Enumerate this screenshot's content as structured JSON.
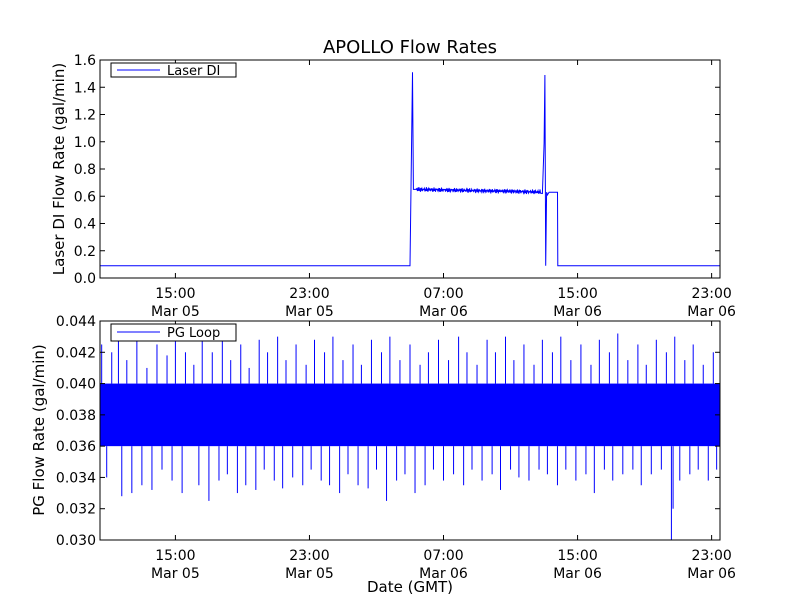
{
  "figure": {
    "title": "APOLLO Flow Rates",
    "xlabel": "Date (GMT)"
  },
  "chart_data": [
    {
      "type": "line",
      "ylabel": "Laser DI Flow Rate (gal/min)",
      "ylim": [
        0.0,
        1.6
      ],
      "yticks": [
        "0.0",
        "0.2",
        "0.4",
        "0.6",
        "0.8",
        "1.0",
        "1.2",
        "1.4",
        "1.6"
      ],
      "xlim_hours": [
        10.5,
        47.5
      ],
      "xticks": [
        {
          "h": 15,
          "time": "15:00",
          "date": "Mar 05"
        },
        {
          "h": 23,
          "time": "23:00",
          "date": "Mar 05"
        },
        {
          "h": 31,
          "time": "07:00",
          "date": "Mar 06"
        },
        {
          "h": 39,
          "time": "15:00",
          "date": "Mar 06"
        },
        {
          "h": 47,
          "time": "23:00",
          "date": "Mar 06"
        }
      ],
      "legend": {
        "label": "Laser DI",
        "loc": "upper left"
      },
      "color": "#0000ff",
      "x_hours": [
        10.5,
        29.0,
        29.15,
        29.2,
        29.3,
        31.0,
        33.0,
        35.0,
        36.5,
        36.9,
        37.0,
        37.05,
        37.1,
        37.15,
        37.2,
        37.3,
        37.6,
        37.8,
        37.82,
        37.85,
        37.9,
        47.5
      ],
      "y": [
        0.09,
        0.09,
        1.51,
        0.65,
        0.65,
        0.65,
        0.64,
        0.64,
        0.63,
        0.62,
        0.99,
        1.49,
        0.09,
        0.63,
        0.61,
        0.63,
        0.63,
        0.63,
        0.09,
        0.09,
        0.09,
        0.09
      ]
    },
    {
      "type": "line",
      "ylabel": "PG Flow Rate (gal/min)",
      "ylim": [
        0.03,
        0.044
      ],
      "yticks": [
        "0.030",
        "0.032",
        "0.034",
        "0.036",
        "0.038",
        "0.040",
        "0.042",
        "0.044"
      ],
      "xlim_hours": [
        10.5,
        47.5
      ],
      "xticks": [
        {
          "h": 15,
          "time": "15:00",
          "date": "Mar 05"
        },
        {
          "h": 23,
          "time": "23:00",
          "date": "Mar 05"
        },
        {
          "h": 31,
          "time": "07:00",
          "date": "Mar 06"
        },
        {
          "h": 39,
          "time": "15:00",
          "date": "Mar 06"
        },
        {
          "h": 47,
          "time": "23:00",
          "date": "Mar 06"
        }
      ],
      "legend": {
        "label": "PG Loop",
        "loc": "upper left"
      },
      "color": "#0000ff",
      "baseline_band": [
        0.036,
        0.04
      ],
      "spikes_up": [
        [
          10.6,
          0.0425
        ],
        [
          11.2,
          0.042
        ],
        [
          11.6,
          0.043
        ],
        [
          12.1,
          0.0415
        ],
        [
          12.7,
          0.0428
        ],
        [
          13.3,
          0.041
        ],
        [
          13.9,
          0.0425
        ],
        [
          14.5,
          0.0418
        ],
        [
          15.0,
          0.043
        ],
        [
          15.6,
          0.042
        ],
        [
          16.1,
          0.0412
        ],
        [
          16.6,
          0.0428
        ],
        [
          17.2,
          0.042
        ],
        [
          17.8,
          0.043
        ],
        [
          18.3,
          0.0415
        ],
        [
          18.9,
          0.0425
        ],
        [
          19.4,
          0.041
        ],
        [
          20.0,
          0.0428
        ],
        [
          20.5,
          0.042
        ],
        [
          21.1,
          0.043
        ],
        [
          21.6,
          0.0415
        ],
        [
          22.2,
          0.0425
        ],
        [
          22.8,
          0.0412
        ],
        [
          23.3,
          0.0428
        ],
        [
          23.9,
          0.042
        ],
        [
          24.4,
          0.043
        ],
        [
          25.0,
          0.0415
        ],
        [
          25.6,
          0.0425
        ],
        [
          26.1,
          0.0412
        ],
        [
          26.7,
          0.0428
        ],
        [
          27.3,
          0.042
        ],
        [
          27.8,
          0.043
        ],
        [
          28.4,
          0.0415
        ],
        [
          29.0,
          0.0425
        ],
        [
          29.6,
          0.0412
        ],
        [
          30.1,
          0.042
        ],
        [
          30.7,
          0.0428
        ],
        [
          31.3,
          0.0415
        ],
        [
          31.9,
          0.043
        ],
        [
          32.4,
          0.042
        ],
        [
          33.0,
          0.0412
        ],
        [
          33.6,
          0.0428
        ],
        [
          34.1,
          0.042
        ],
        [
          34.7,
          0.043
        ],
        [
          35.2,
          0.0415
        ],
        [
          35.8,
          0.0425
        ],
        [
          36.4,
          0.0412
        ],
        [
          36.9,
          0.0428
        ],
        [
          37.5,
          0.042
        ],
        [
          38.0,
          0.043
        ],
        [
          38.6,
          0.0415
        ],
        [
          39.2,
          0.0425
        ],
        [
          39.8,
          0.0412
        ],
        [
          40.3,
          0.0428
        ],
        [
          40.9,
          0.042
        ],
        [
          41.4,
          0.0432
        ],
        [
          42.0,
          0.0415
        ],
        [
          42.6,
          0.0425
        ],
        [
          43.1,
          0.0412
        ],
        [
          43.7,
          0.0428
        ],
        [
          44.3,
          0.042
        ],
        [
          44.8,
          0.043
        ],
        [
          45.4,
          0.0415
        ],
        [
          45.9,
          0.0425
        ],
        [
          46.5,
          0.0412
        ],
        [
          47.1,
          0.042
        ]
      ],
      "spikes_down": [
        [
          10.9,
          0.034
        ],
        [
          11.8,
          0.0328
        ],
        [
          12.4,
          0.033
        ],
        [
          13.0,
          0.0335
        ],
        [
          13.6,
          0.0332
        ],
        [
          14.2,
          0.0345
        ],
        [
          14.8,
          0.0338
        ],
        [
          15.4,
          0.033
        ],
        [
          16.4,
          0.0335
        ],
        [
          17.0,
          0.0325
        ],
        [
          17.6,
          0.0338
        ],
        [
          18.1,
          0.0342
        ],
        [
          18.7,
          0.033
        ],
        [
          19.2,
          0.0335
        ],
        [
          19.8,
          0.0332
        ],
        [
          20.3,
          0.0345
        ],
        [
          20.9,
          0.0338
        ],
        [
          21.4,
          0.0333
        ],
        [
          22.0,
          0.034
        ],
        [
          22.6,
          0.0335
        ],
        [
          23.1,
          0.0345
        ],
        [
          23.7,
          0.0338
        ],
        [
          24.2,
          0.0335
        ],
        [
          24.8,
          0.033
        ],
        [
          25.3,
          0.0342
        ],
        [
          25.9,
          0.0335
        ],
        [
          26.5,
          0.0333
        ],
        [
          27.0,
          0.0345
        ],
        [
          27.6,
          0.0325
        ],
        [
          28.2,
          0.0338
        ],
        [
          28.7,
          0.0342
        ],
        [
          29.3,
          0.033
        ],
        [
          29.9,
          0.0335
        ],
        [
          30.4,
          0.0345
        ],
        [
          31.0,
          0.0338
        ],
        [
          31.6,
          0.0342
        ],
        [
          32.2,
          0.0335
        ],
        [
          32.7,
          0.0345
        ],
        [
          33.3,
          0.0338
        ],
        [
          33.9,
          0.0342
        ],
        [
          34.4,
          0.0332
        ],
        [
          35.0,
          0.0345
        ],
        [
          35.5,
          0.034
        ],
        [
          36.1,
          0.0338
        ],
        [
          36.7,
          0.0345
        ],
        [
          37.2,
          0.0342
        ],
        [
          37.8,
          0.0335
        ],
        [
          38.3,
          0.0345
        ],
        [
          38.9,
          0.0338
        ],
        [
          39.5,
          0.0342
        ],
        [
          40.0,
          0.033
        ],
        [
          40.6,
          0.0345
        ],
        [
          41.1,
          0.0338
        ],
        [
          41.7,
          0.0342
        ],
        [
          42.3,
          0.0345
        ],
        [
          42.8,
          0.0335
        ],
        [
          43.4,
          0.0342
        ],
        [
          44.0,
          0.0345
        ],
        [
          44.6,
          0.03
        ],
        [
          44.7,
          0.032
        ],
        [
          45.1,
          0.0338
        ],
        [
          45.7,
          0.0342
        ],
        [
          46.2,
          0.0345
        ],
        [
          46.8,
          0.0338
        ],
        [
          47.3,
          0.0345
        ]
      ]
    }
  ]
}
